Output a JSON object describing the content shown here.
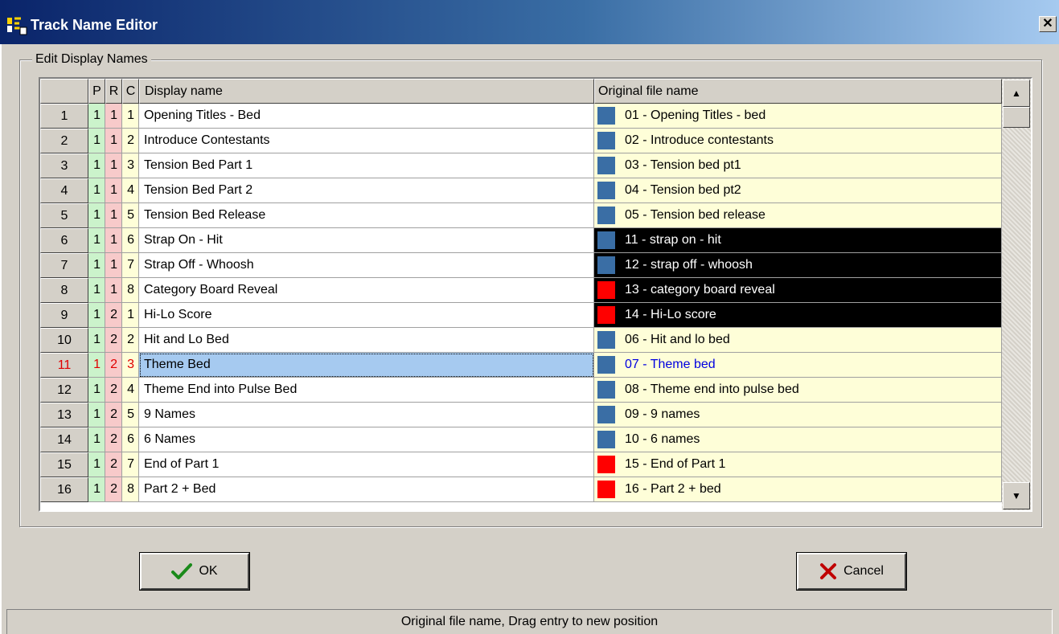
{
  "window": {
    "title": "Track Name Editor",
    "close_label": "✕"
  },
  "group": {
    "legend": "Edit Display Names"
  },
  "grid": {
    "headers": {
      "num": "",
      "p": "P",
      "r": "R",
      "c": "C",
      "name": "Display name",
      "orig": "Original file name"
    },
    "rows": [
      {
        "num": "1",
        "p": "1",
        "r": "1",
        "c": "1",
        "name": "Opening Titles - Bed",
        "orig": "01 - Opening Titles - bed",
        "swatch": "#3a6ea5",
        "dark": false
      },
      {
        "num": "2",
        "p": "1",
        "r": "1",
        "c": "2",
        "name": "Introduce Contestants",
        "orig": "02 - Introduce contestants",
        "swatch": "#3a6ea5",
        "dark": false
      },
      {
        "num": "3",
        "p": "1",
        "r": "1",
        "c": "3",
        "name": "Tension Bed Part 1",
        "orig": "03 - Tension bed pt1",
        "swatch": "#3a6ea5",
        "dark": false
      },
      {
        "num": "4",
        "p": "1",
        "r": "1",
        "c": "4",
        "name": "Tension Bed Part 2",
        "orig": "04 - Tension bed pt2",
        "swatch": "#3a6ea5",
        "dark": false
      },
      {
        "num": "5",
        "p": "1",
        "r": "1",
        "c": "5",
        "name": "Tension Bed Release",
        "orig": "05 - Tension bed release",
        "swatch": "#3a6ea5",
        "dark": false
      },
      {
        "num": "6",
        "p": "1",
        "r": "1",
        "c": "6",
        "name": "Strap On - Hit",
        "orig": "11 - strap on - hit",
        "swatch": "#3a6ea5",
        "dark": true
      },
      {
        "num": "7",
        "p": "1",
        "r": "1",
        "c": "7",
        "name": "Strap Off - Whoosh",
        "orig": "12 - strap off - whoosh",
        "swatch": "#3a6ea5",
        "dark": true
      },
      {
        "num": "8",
        "p": "1",
        "r": "1",
        "c": "8",
        "name": "Category Board Reveal",
        "orig": "13 - category board reveal",
        "swatch": "#ff0000",
        "dark": true
      },
      {
        "num": "9",
        "p": "1",
        "r": "2",
        "c": "1",
        "name": "Hi-Lo Score",
        "orig": "14 - Hi-Lo score",
        "swatch": "#ff0000",
        "dark": true
      },
      {
        "num": "10",
        "p": "1",
        "r": "2",
        "c": "2",
        "name": "Hit and Lo Bed",
        "orig": "06 - Hit and lo bed",
        "swatch": "#3a6ea5",
        "dark": false
      },
      {
        "num": "11",
        "p": "1",
        "r": "2",
        "c": "3",
        "name": "Theme Bed",
        "orig": "07 - Theme bed",
        "swatch": "#3a6ea5",
        "dark": false,
        "selected": true
      },
      {
        "num": "12",
        "p": "1",
        "r": "2",
        "c": "4",
        "name": "Theme End into Pulse Bed",
        "orig": "08 - Theme end into pulse bed",
        "swatch": "#3a6ea5",
        "dark": false
      },
      {
        "num": "13",
        "p": "1",
        "r": "2",
        "c": "5",
        "name": "9 Names",
        "orig": "09 - 9 names",
        "swatch": "#3a6ea5",
        "dark": false
      },
      {
        "num": "14",
        "p": "1",
        "r": "2",
        "c": "6",
        "name": "6 Names",
        "orig": "10 - 6 names",
        "swatch": "#3a6ea5",
        "dark": false
      },
      {
        "num": "15",
        "p": "1",
        "r": "2",
        "c": "7",
        "name": "End of Part 1",
        "orig": "15 - End of Part 1",
        "swatch": "#ff0000",
        "dark": false
      },
      {
        "num": "16",
        "p": "1",
        "r": "2",
        "c": "8",
        "name": "Part 2 + Bed",
        "orig": "16 - Part 2 + bed",
        "swatch": "#ff0000",
        "dark": false
      }
    ],
    "scroll": {
      "up_icon": "▲",
      "down_icon": "▼"
    }
  },
  "buttons": {
    "ok_label": "OK",
    "cancel_label": "Cancel"
  },
  "status": {
    "text": "Original file name, Drag entry to new position"
  }
}
